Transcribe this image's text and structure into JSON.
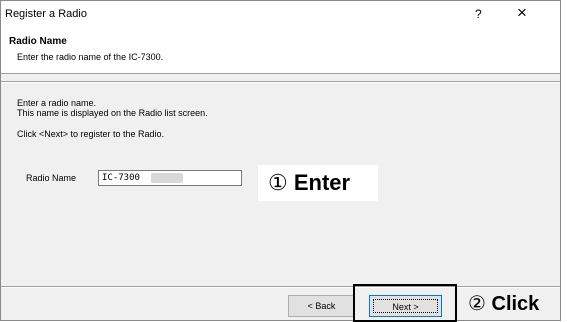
{
  "window": {
    "title": "Register a Radio",
    "help_label": "?",
    "close_label": "×"
  },
  "header": {
    "title": "Radio Name",
    "subtitle": "Enter the radio name of the IC-7300."
  },
  "body": {
    "line1": "Enter a radio name.",
    "line2": "This name is displayed on the Radio list screen.",
    "line3": "Click <Next> to register to the Radio."
  },
  "field": {
    "label": "Radio Name",
    "value": "IC-7300"
  },
  "buttons": {
    "back_label": "< Back",
    "next_label": "Next >"
  },
  "annotations": {
    "step1_number": "①",
    "step1_word": "Enter",
    "step2_number": "②",
    "step2_word": "Click"
  }
}
